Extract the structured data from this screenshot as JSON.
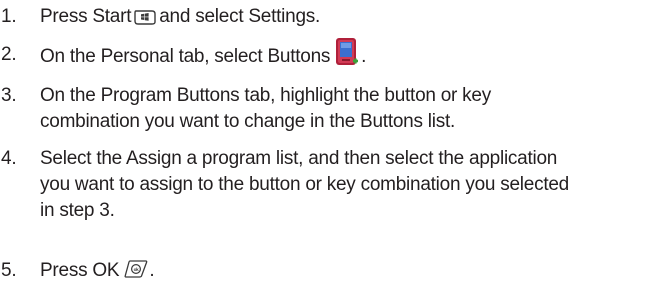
{
  "steps": [
    {
      "number": "1.",
      "parts": [
        "Press Start",
        "and select Settings."
      ],
      "icon": "start-key-icon"
    },
    {
      "number": "2.",
      "parts": [
        "On the Personal tab, select Buttons",
        "."
      ],
      "icon": "buttons-settings-icon"
    },
    {
      "number": "3.",
      "lines": [
        "On the Program Buttons tab, highlight the button or key",
        "combination you want to change in the Buttons list."
      ]
    },
    {
      "number": "4.",
      "lines": [
        "Select the Assign a program list, and then select the application",
        "you want to assign to the button or key combination you selected",
        "in step 3."
      ]
    },
    {
      "number": "5.",
      "parts": [
        "Press OK",
        "."
      ],
      "icon": "ok-key-icon"
    }
  ],
  "colors": {
    "text": "#231f20",
    "icon_outline": "#3a3a3a",
    "buttons_icon_red": "#b0203a",
    "buttons_icon_blue": "#3a6fd0",
    "buttons_icon_green": "#3aa13a"
  }
}
